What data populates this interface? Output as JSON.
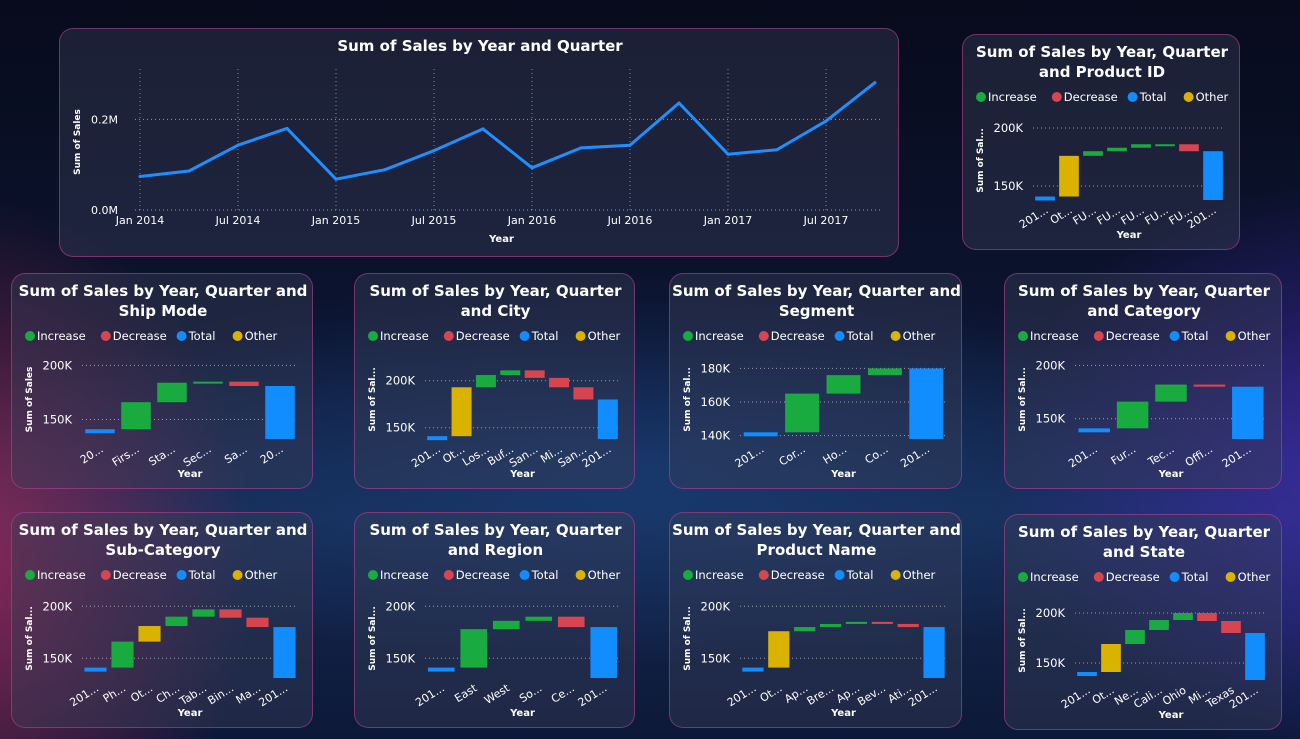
{
  "colors": {
    "increase": "#1aab40",
    "decrease": "#d64550",
    "total": "#118dff",
    "other": "#d9b300",
    "line": "#1f8fff"
  },
  "legend": [
    {
      "key": "increase",
      "label": "Increase"
    },
    {
      "key": "decrease",
      "label": "Decrease"
    },
    {
      "key": "total",
      "label": "Total"
    },
    {
      "key": "other",
      "label": "Other"
    }
  ],
  "line_chart": {
    "title": "Sum of Sales by Year and Quarter",
    "xlabel": "Year",
    "ylabel": "Sum of Sales",
    "chart_data": {
      "type": "line",
      "x": [
        "2014 Q1",
        "2014 Q2",
        "2014 Q3",
        "2014 Q4",
        "2015 Q1",
        "2015 Q2",
        "2015 Q3",
        "2015 Q4",
        "2016 Q1",
        "2016 Q2",
        "2016 Q3",
        "2016 Q4",
        "2017 Q1",
        "2017 Q2",
        "2017 Q3",
        "2017 Q4"
      ],
      "values": [
        74000,
        86000,
        143000,
        180000,
        68000,
        89000,
        131000,
        179000,
        93000,
        137000,
        143000,
        236000,
        123000,
        133000,
        196000,
        281000
      ],
      "x_tick_labels": [
        "Jan 2014",
        "Jul 2014",
        "Jan 2015",
        "Jul 2015",
        "Jan 2016",
        "Jul 2016",
        "Jan 2017",
        "Jul 2017"
      ],
      "y_ticks": [
        {
          "value": 0,
          "label": "0.0M"
        },
        {
          "value": 200000,
          "label": "0.2M"
        }
      ],
      "ylim": [
        0,
        300000
      ],
      "grid": true
    }
  },
  "waterfalls": [
    {
      "title": [
        "Sum of Sales by Year, Quarter",
        "and Product ID"
      ],
      "ylabel": "Sum of Sal...",
      "xlabel": "Year",
      "chart_data": {
        "type": "waterfall",
        "ylim": [
          138000,
          206000
        ],
        "y_ticks": [
          {
            "value": 150000,
            "label": "150K"
          },
          {
            "value": 200000,
            "label": "200K"
          }
        ],
        "categories": [
          "201...",
          "Ot...",
          "FU...",
          "FU...",
          "FU...",
          "FU...",
          "FU...",
          "201..."
        ],
        "kinds": [
          "total",
          "other",
          "increase",
          "increase",
          "increase",
          "increase",
          "decrease",
          "total"
        ],
        "values": [
          141000,
          176000,
          180000,
          183000,
          186000,
          186000,
          180000,
          180000
        ]
      }
    },
    {
      "title": [
        "Sum of Sales by Year, Quarter and",
        "Ship Mode"
      ],
      "ylabel": "Sum of Sales",
      "xlabel": "Year",
      "chart_data": {
        "type": "waterfall",
        "ylim": [
          132000,
          205000
        ],
        "y_ticks": [
          {
            "value": 150000,
            "label": "150K"
          },
          {
            "value": 200000,
            "label": "200K"
          }
        ],
        "categories": [
          "20...",
          "Firs...",
          "Sta...",
          "Sec...",
          "Sa...",
          "20..."
        ],
        "kinds": [
          "total",
          "increase",
          "increase",
          "increase",
          "decrease",
          "total"
        ],
        "values": [
          141000,
          166000,
          184000,
          185000,
          181000,
          181000
        ]
      }
    },
    {
      "title": [
        "Sum of Sales by Year, Quarter",
        "and City"
      ],
      "ylabel": "Sum of Sal...",
      "xlabel": "Year",
      "chart_data": {
        "type": "waterfall",
        "ylim": [
          138000,
          222000
        ],
        "y_ticks": [
          {
            "value": 150000,
            "label": "150K"
          },
          {
            "value": 200000,
            "label": "200K"
          }
        ],
        "categories": [
          "201...",
          "Ot...",
          "Los...",
          "Buf...",
          "San...",
          "Mi...",
          "San...",
          "201..."
        ],
        "kinds": [
          "total",
          "other",
          "increase",
          "increase",
          "decrease",
          "decrease",
          "decrease",
          "total"
        ],
        "values": [
          141000,
          193000,
          206000,
          211000,
          203000,
          193000,
          180000,
          180000
        ]
      }
    },
    {
      "title": [
        "Sum of Sales by Year, Quarter and",
        "Segment"
      ],
      "ylabel": "Sum of Sal...",
      "xlabel": "Year",
      "chart_data": {
        "type": "waterfall",
        "ylim": [
          138000,
          185000
        ],
        "y_ticks": [
          {
            "value": 140000,
            "label": "140K"
          },
          {
            "value": 160000,
            "label": "160K"
          },
          {
            "value": 180000,
            "label": "180K"
          }
        ],
        "categories": [
          "201...",
          "Cor...",
          "Ho...",
          "Co...",
          "201..."
        ],
        "kinds": [
          "total",
          "increase",
          "increase",
          "increase",
          "total"
        ],
        "values": [
          142000,
          165000,
          176000,
          180000,
          180000
        ]
      }
    },
    {
      "title": [
        "Sum of Sales by Year, Quarter",
        "and Category"
      ],
      "ylabel": "Sum of Sal...",
      "xlabel": "Year",
      "chart_data": {
        "type": "waterfall",
        "ylim": [
          131000,
          205000
        ],
        "y_ticks": [
          {
            "value": 150000,
            "label": "150K"
          },
          {
            "value": 200000,
            "label": "200K"
          }
        ],
        "categories": [
          "201...",
          "Fur...",
          "Tec...",
          "Offi...",
          "201..."
        ],
        "kinds": [
          "total",
          "increase",
          "increase",
          "decrease",
          "total"
        ],
        "values": [
          141000,
          166000,
          182000,
          180000,
          180000
        ]
      }
    },
    {
      "title": [
        "Sum of Sales by Year, Quarter and",
        "Sub-Category"
      ],
      "ylabel": "Sum of Sal...",
      "xlabel": "Year",
      "chart_data": {
        "type": "waterfall",
        "ylim": [
          131000,
          207000
        ],
        "y_ticks": [
          {
            "value": 150000,
            "label": "150K"
          },
          {
            "value": 200000,
            "label": "200K"
          }
        ],
        "categories": [
          "201...",
          "Ph...",
          "Ot...",
          "Ch...",
          "Tab...",
          "Bin...",
          "Ma...",
          "201..."
        ],
        "kinds": [
          "total",
          "increase",
          "other",
          "increase",
          "increase",
          "decrease",
          "decrease",
          "total"
        ],
        "values": [
          141000,
          166000,
          181000,
          190000,
          197000,
          189000,
          180000,
          180000
        ]
      }
    },
    {
      "title": [
        "Sum of Sales by Year, Quarter",
        "and Region"
      ],
      "ylabel": "Sum of Sal...",
      "xlabel": "Year",
      "chart_data": {
        "type": "waterfall",
        "ylim": [
          131000,
          207000
        ],
        "y_ticks": [
          {
            "value": 150000,
            "label": "150K"
          },
          {
            "value": 200000,
            "label": "200K"
          }
        ],
        "categories": [
          "201...",
          "East",
          "West",
          "So...",
          "Ce...",
          "201..."
        ],
        "kinds": [
          "total",
          "increase",
          "increase",
          "increase",
          "decrease",
          "total"
        ],
        "values": [
          141000,
          178000,
          186000,
          190000,
          180000,
          180000
        ]
      }
    },
    {
      "title": [
        "Sum of Sales by Year, Quarter and",
        "Product Name"
      ],
      "ylabel": "Sum of Sal...",
      "xlabel": "Year",
      "chart_data": {
        "type": "waterfall",
        "ylim": [
          131000,
          207000
        ],
        "y_ticks": [
          {
            "value": 150000,
            "label": "150K"
          },
          {
            "value": 200000,
            "label": "200K"
          }
        ],
        "categories": [
          "201...",
          "Ot...",
          "Ap...",
          "Bre...",
          "Ap...",
          "Bev...",
          "Ati...",
          "201..."
        ],
        "kinds": [
          "total",
          "other",
          "increase",
          "increase",
          "increase",
          "decrease",
          "decrease",
          "total"
        ],
        "values": [
          141000,
          176000,
          180000,
          183000,
          185000,
          183000,
          180000,
          180000
        ]
      }
    },
    {
      "title": [
        "Sum of Sales by Year, Quarter",
        "and State"
      ],
      "ylabel": "Sum of Sal...",
      "xlabel": "Year",
      "chart_data": {
        "type": "waterfall",
        "ylim": [
          133000,
          212000
        ],
        "y_ticks": [
          {
            "value": 150000,
            "label": "150K"
          },
          {
            "value": 200000,
            "label": "200K"
          }
        ],
        "categories": [
          "201...",
          "Ot...",
          "Ne...",
          "Cali...",
          "Ohio",
          "Mi...",
          "Texas",
          "201..."
        ],
        "kinds": [
          "total",
          "other",
          "increase",
          "increase",
          "increase",
          "decrease",
          "decrease",
          "total"
        ],
        "values": [
          141000,
          169000,
          183000,
          193000,
          200000,
          192000,
          180000,
          180000
        ]
      }
    }
  ]
}
